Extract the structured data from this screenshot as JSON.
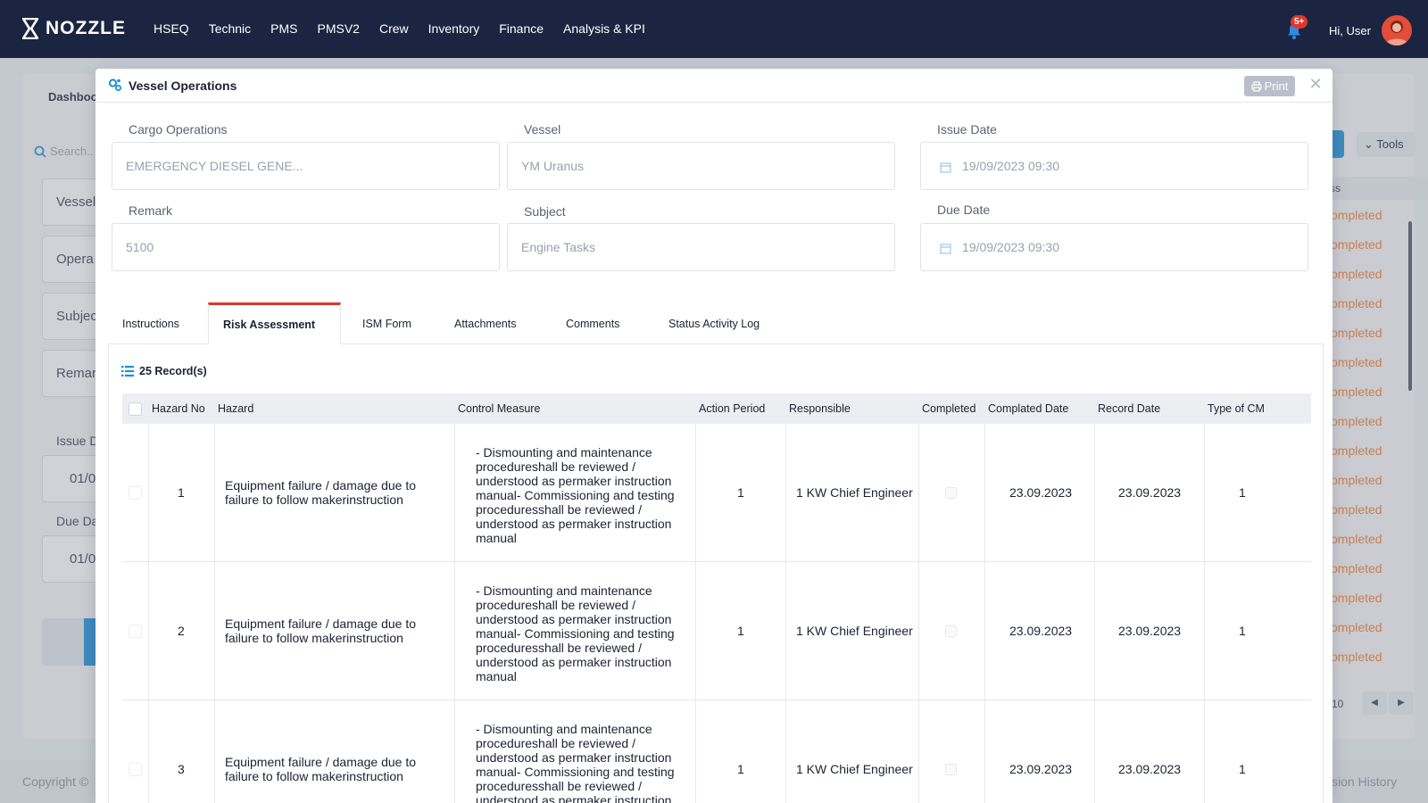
{
  "brand": "NOZZLE",
  "nav": [
    "HSEQ",
    "Technic",
    "PMS",
    "PMSV2",
    "Crew",
    "Inventory",
    "Finance",
    "Analysis & KPI"
  ],
  "notifications": "5+",
  "greeting": "Hi, User",
  "background": {
    "dashboard_label": "Dashboc",
    "search_placeholder": "Search..",
    "fields": [
      "Vessel",
      "Opera",
      "Subjec",
      "Remar"
    ],
    "issue_label": "Issue D",
    "due_label": "Due Da",
    "issue_value": "01/0",
    "due_value": "01/0",
    "tools": "Tools",
    "status_header": "ss",
    "statuses": [
      "ompleted",
      "ompleted",
      "ompleted",
      "ompleted",
      "ompleted",
      "ompleted",
      "ompleted",
      "ompleted",
      "ompleted",
      "ompleted",
      "ompleted",
      "ompleted",
      "ompleted",
      "ompleted",
      "ompleted",
      "ompleted"
    ],
    "pager_size": "10",
    "copyright": "Copyright ©",
    "version_history": "sion History"
  },
  "modal": {
    "title": "Vessel Operations",
    "print": "Print",
    "fields": {
      "cargo_label": "Cargo Operations",
      "cargo_value": "EMERGENCY DIESEL GENE...",
      "vessel_label": "Vessel",
      "vessel_value": "YM Uranus",
      "issue_label": "Issue Date",
      "issue_value": "19/09/2023 09:30",
      "remark_label": "Remark",
      "remark_value": "5100",
      "subject_label": "Subject",
      "subject_value": "Engine Tasks",
      "due_label": "Due Date",
      "due_value": "19/09/2023 09:30"
    },
    "tabs": [
      "Instructions",
      "Risk Assessment",
      "ISM Form",
      "Attachments",
      "Comments",
      "Status Activity Log"
    ],
    "active_tab": "Risk Assessment",
    "records": "25 Record(s)",
    "columns": [
      "Hazard No",
      "Hazard",
      "Control Measure",
      "Action Period",
      "Responsible",
      "Completed",
      "Complated Date",
      "Record Date",
      "Type of CM"
    ],
    "rows": [
      {
        "no": "1",
        "hazard": "Equipment failure / damage due to failure to follow makerinstruction",
        "control": "- Dismounting and maintenance procedureshall be reviewed / understood as permaker instruction manual- Commissioning and testing proceduresshall be reviewed / understood as permaker instruction manual",
        "period": "1",
        "responsible": "1 KW Chief Engineer",
        "completed_date": "23.09.2023",
        "record_date": "23.09.2023",
        "type": "1"
      },
      {
        "no": "2",
        "hazard": "Equipment failure / damage due to failure to follow makerinstruction",
        "control": "- Dismounting and maintenance procedureshall be reviewed / understood as permaker instruction manual- Commissioning and testing proceduresshall be reviewed / understood as permaker instruction manual",
        "period": "1",
        "responsible": "1 KW Chief Engineer",
        "completed_date": "23.09.2023",
        "record_date": "23.09.2023",
        "type": "1"
      },
      {
        "no": "3",
        "hazard": "Equipment failure / damage due to failure to follow makerinstruction",
        "control": "- Dismounting and maintenance procedureshall be reviewed / understood as permaker instruction manual- Commissioning and testing proceduresshall be reviewed / understood as permaker instruction manual",
        "period": "1",
        "responsible": "1 KW Chief Engineer",
        "completed_date": "23.09.2023",
        "record_date": "23.09.2023",
        "type": "1"
      }
    ]
  }
}
